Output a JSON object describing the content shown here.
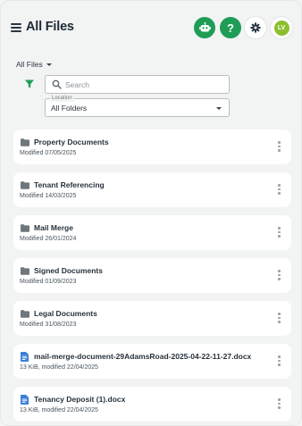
{
  "header": {
    "title": "All Files",
    "avatar_initials": "LV",
    "help_glyph": "?"
  },
  "toolbar": {
    "scope_label": "All Files"
  },
  "search": {
    "placeholder": "Search",
    "value": ""
  },
  "location": {
    "label": "Location",
    "value": "All Folders"
  },
  "files": [
    {
      "type": "folder",
      "name": "Property Documents",
      "meta": "Modified 07/05/2025"
    },
    {
      "type": "folder",
      "name": "Tenant Referencing",
      "meta": "Modified 14/03/2025"
    },
    {
      "type": "folder",
      "name": "Mail Merge",
      "meta": "Modified 26/01/2024"
    },
    {
      "type": "folder",
      "name": "Signed Documents",
      "meta": "Modified 01/09/2023"
    },
    {
      "type": "folder",
      "name": "Legal Documents",
      "meta": "Modified 31/08/2023"
    },
    {
      "type": "document",
      "name": "mail-merge-document-29AdamsRoad-2025-04-22-11-27.docx",
      "meta": "13 KiB, modified 22/04/2025"
    },
    {
      "type": "document",
      "name": "Tenancy Deposit (1).docx",
      "meta": "13 KiB, modified 22/04/2025"
    }
  ],
  "icons": {
    "menu": "hamburger-menu-icon",
    "bot": "robot-icon",
    "help": "help-icon",
    "settings": "settings-icon",
    "filter": "filter-icon",
    "search": "search-icon",
    "folder": "folder-icon",
    "document": "document-icon",
    "more": "more-vertical-icon"
  },
  "colors": {
    "accent_green": "#1f9d57",
    "avatar_green": "#8cbf2f",
    "doc_blue": "#3d7fd6",
    "folder_grey": "#6f777d"
  }
}
